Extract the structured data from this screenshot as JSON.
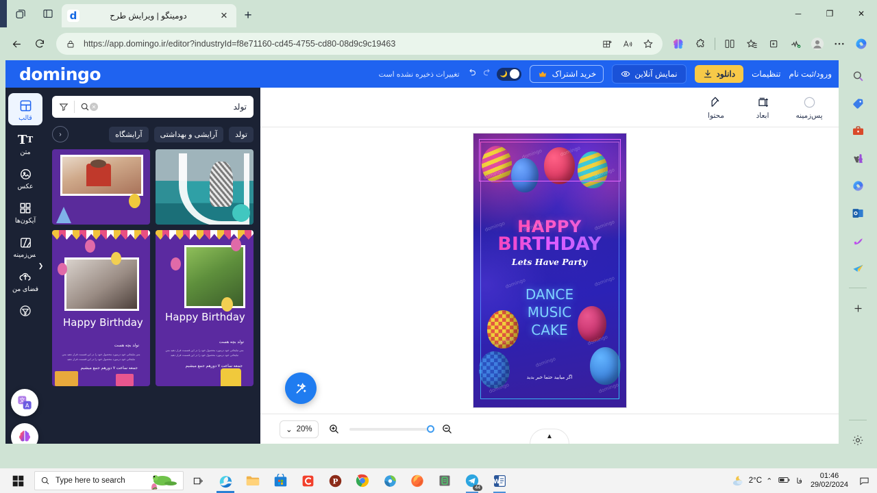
{
  "browser": {
    "tab": {
      "title": "دومینگو | ویرایش طرح",
      "favicon": "d",
      "close": "✕"
    },
    "newtab_label": "+",
    "window_controls": {
      "minimize": "─",
      "maximize": "❐",
      "close": "✕"
    },
    "nav": {
      "back": "←",
      "reload": "⟳"
    },
    "address": {
      "lock_icon": "lock-icon",
      "url_prefix": "https://",
      "url_host": "app.domingo.ir",
      "url_path": "/editor?industryId=f8e71160-cd45-4755-cd80-08d9c9c19463",
      "url_full": "https://app.domingo.ir/editor?industryId=f8e71160-cd45-4755-cd80-08d9c9c19463"
    },
    "toolbar_icons": [
      "split-screen-icon",
      "read-aloud-icon",
      "favorite-star-icon",
      "copilot-icon",
      "extensions-icon",
      "split-view-icon",
      "collections-icon",
      "browser-essentials-icon",
      "profile-icon",
      "more-icon",
      "copilot-sidebar-icon"
    ],
    "sidebar_icons": [
      "search-icon",
      "shopping-tag-icon",
      "tools-briefcase-icon",
      "games-icon",
      "copilot-icon",
      "outlook-icon",
      "designer-icon",
      "telegram-icon",
      "add-icon",
      "settings-gear-icon"
    ]
  },
  "app": {
    "logo": "domingo",
    "save_status": "تغییرات ذخیره نشده است",
    "undo_icon": "undo-icon",
    "redo_icon": "redo-icon",
    "header_actions": {
      "login": "ورود/ثبت نام",
      "settings": "تنظیمات",
      "download": "دانلود",
      "preview": "نمایش آنلاین",
      "subscribe": "خرید اشتراک",
      "dark_mode": "dark-mode-toggle"
    },
    "tools": [
      {
        "label": "محتوا",
        "icon": "edit-pencil-icon"
      },
      {
        "label": "ابعاد",
        "icon": "dimensions-icon"
      },
      {
        "label": "پس‌زمینه",
        "icon": "background-circle-icon"
      }
    ],
    "canvas": {
      "title_line1": "HAPPY",
      "title_line2": "BIRTHDAY",
      "subtitle": "Lets Have Party",
      "list_line1": "DANCE",
      "list_line2": "MUSIC",
      "list_line3": "CAKE",
      "footer_note": "اگر میایید حتما خبر بدید",
      "watermark": "domingo"
    },
    "zoom": {
      "level": "20%",
      "chevron": "⌄",
      "zoom_in_icon": "zoom-in-icon",
      "zoom_out_icon": "zoom-out-icon",
      "collapse_icon": "▲"
    },
    "magic_button": "magic-wand-icon",
    "panel": {
      "search_value": "تولد",
      "search_icon": "search-icon",
      "filter_icon": "filter-icon",
      "clear_icon": "✕",
      "chips": [
        "تولد",
        "آرایشی و بهداشتی",
        "آرایشگاه"
      ],
      "chip_back": "‹",
      "templates": [
        {
          "name": "template-kids-party",
          "title": ""
        },
        {
          "name": "template-beach",
          "title": ""
        },
        {
          "name": "template-happy-birthday-mother",
          "title": "Happy Birthday",
          "sub": "تولد بچه هست",
          "footer": "جمعه ساعت ۷ دورهم جمع میشیم"
        },
        {
          "name": "template-happy-birthday-child",
          "title": "Happy Birthday",
          "sub": "تولد بچه هست",
          "footer": "جمعه ساعت ۷ دورهم جمع میشیم"
        }
      ],
      "collapse_handle": "❯"
    },
    "rail": [
      {
        "label": "قالب",
        "icon": "template-grid-icon",
        "active": true
      },
      {
        "label": "متن",
        "icon": "text-icon",
        "active": false
      },
      {
        "label": "عکس",
        "icon": "image-icon",
        "active": false
      },
      {
        "label": "آیکون‌ها",
        "icon": "icons-grid-icon",
        "active": false
      },
      {
        "label": "پس‌زمینه",
        "icon": "background-icon",
        "active": false
      },
      {
        "label": "فضای من",
        "icon": "cloud-upload-icon",
        "active": false
      }
    ],
    "rail_float_icons": [
      "translate-icon",
      "ai-brain-icon"
    ]
  },
  "taskbar": {
    "start_icon": "windows-start-icon",
    "search_placeholder": "Type here to search",
    "taskview_icon": "task-view-icon",
    "apps": [
      {
        "name": "edge-icon",
        "badge": ""
      },
      {
        "name": "file-explorer-icon",
        "badge": ""
      },
      {
        "name": "microsoft-store-icon",
        "badge": ""
      },
      {
        "name": "camtasia-icon",
        "badge": ""
      },
      {
        "name": "pdf-app-icon",
        "badge": ""
      },
      {
        "name": "chrome-icon",
        "badge": ""
      },
      {
        "name": "idm-icon",
        "badge": ""
      },
      {
        "name": "firefox-icon",
        "badge": ""
      },
      {
        "name": "green-app-icon",
        "badge": ""
      },
      {
        "name": "telegram-icon",
        "badge": "44"
      },
      {
        "name": "word-icon",
        "badge": ""
      }
    ],
    "weather": "2°C",
    "weather_icon": "partly-cloudy-night-icon",
    "tray_chevron": "⌃",
    "tray_battery": "battery-icon",
    "language": "فا",
    "time": "01:46",
    "date": "29/02/2024",
    "notification_icon": "notification-icon"
  }
}
